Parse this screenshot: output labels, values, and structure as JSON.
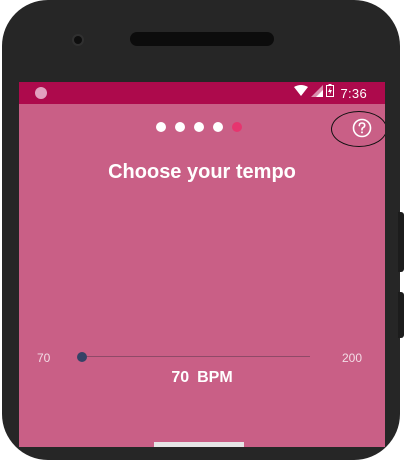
{
  "status_bar": {
    "time": "7:36",
    "icons": [
      "wifi-icon",
      "signal-icon",
      "battery-icon"
    ]
  },
  "pager": {
    "total": 5,
    "active_index": 4
  },
  "help_icon": "help-circle-icon",
  "title": "Choose your tempo",
  "tempo": {
    "min": "70",
    "max": "200",
    "value": "70",
    "unit": "BPM",
    "level": 0.0
  },
  "colors": {
    "background": "#c95f86",
    "status_bar": "#ad0a4c",
    "active_dot": "#e6356f",
    "slider_thumb": "#344266"
  }
}
